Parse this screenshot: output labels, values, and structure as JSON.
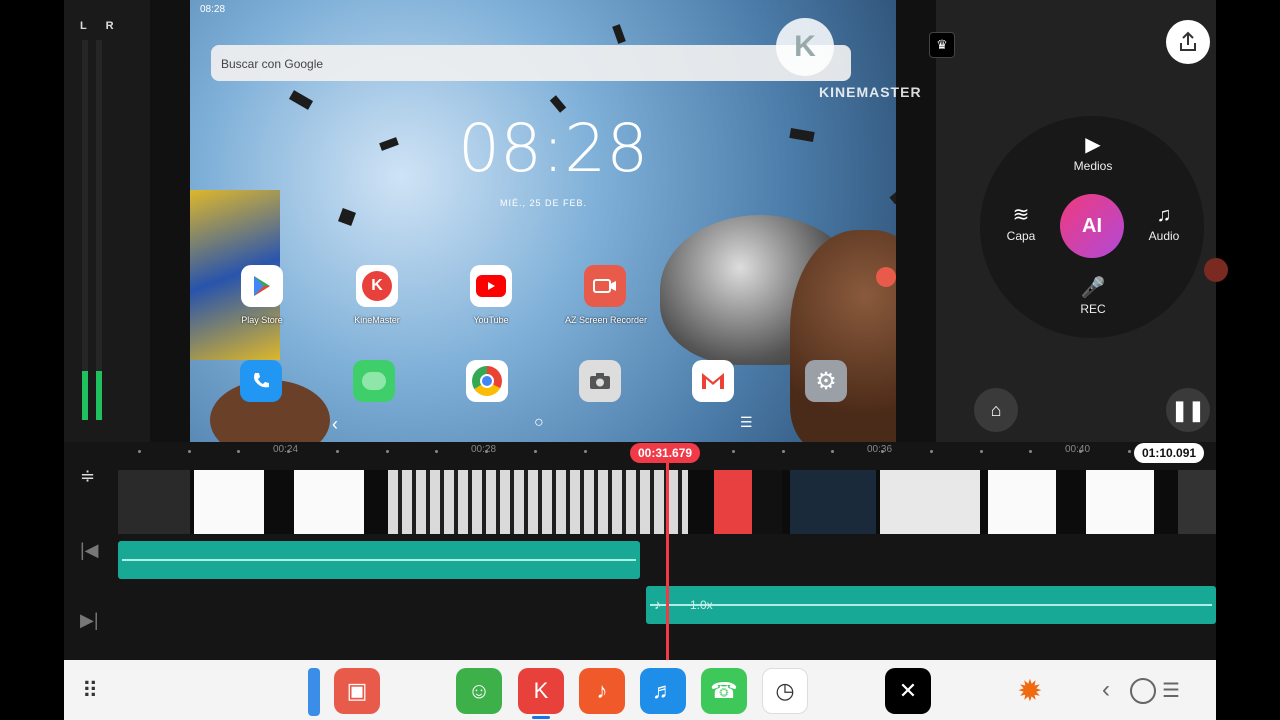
{
  "device": {
    "status_time": "08:28"
  },
  "vu_meter": {
    "label": "L R",
    "left_level": 0.13,
    "right_level": 0.13
  },
  "home_screen": {
    "search_placeholder": "Buscar con Google",
    "clock": "08:28",
    "date": "MIÉ., 25 DE FEB.",
    "apps": [
      {
        "label": "Play Store",
        "icon": "play-store-icon"
      },
      {
        "label": "KineMaster",
        "icon": "kinemaster-icon"
      },
      {
        "label": "YouTube",
        "icon": "youtube-icon"
      },
      {
        "label": "AZ Screen Recorder",
        "icon": "camera-recorder-icon"
      }
    ],
    "dock_apps": [
      "phone-icon",
      "messages-icon",
      "chrome-icon",
      "camera-icon",
      "gmail-icon",
      "settings-icon"
    ]
  },
  "watermark": {
    "text": "KINEMASTER"
  },
  "menu": {
    "media": "Medios",
    "layer": "Capa",
    "ai": "AI",
    "audio": "Audio",
    "rec": "REC"
  },
  "timeline": {
    "ticks": [
      "00:24",
      "00:28",
      "00:36",
      "00:40"
    ],
    "playhead_time": "00:31.679",
    "total_time": "01:10.091",
    "audio_speed": "1.0x"
  },
  "colors": {
    "accent": "#f03a47",
    "audio_track": "#17a896",
    "ai_start": "#f03a7c",
    "ai_end": "#b04ad8"
  }
}
